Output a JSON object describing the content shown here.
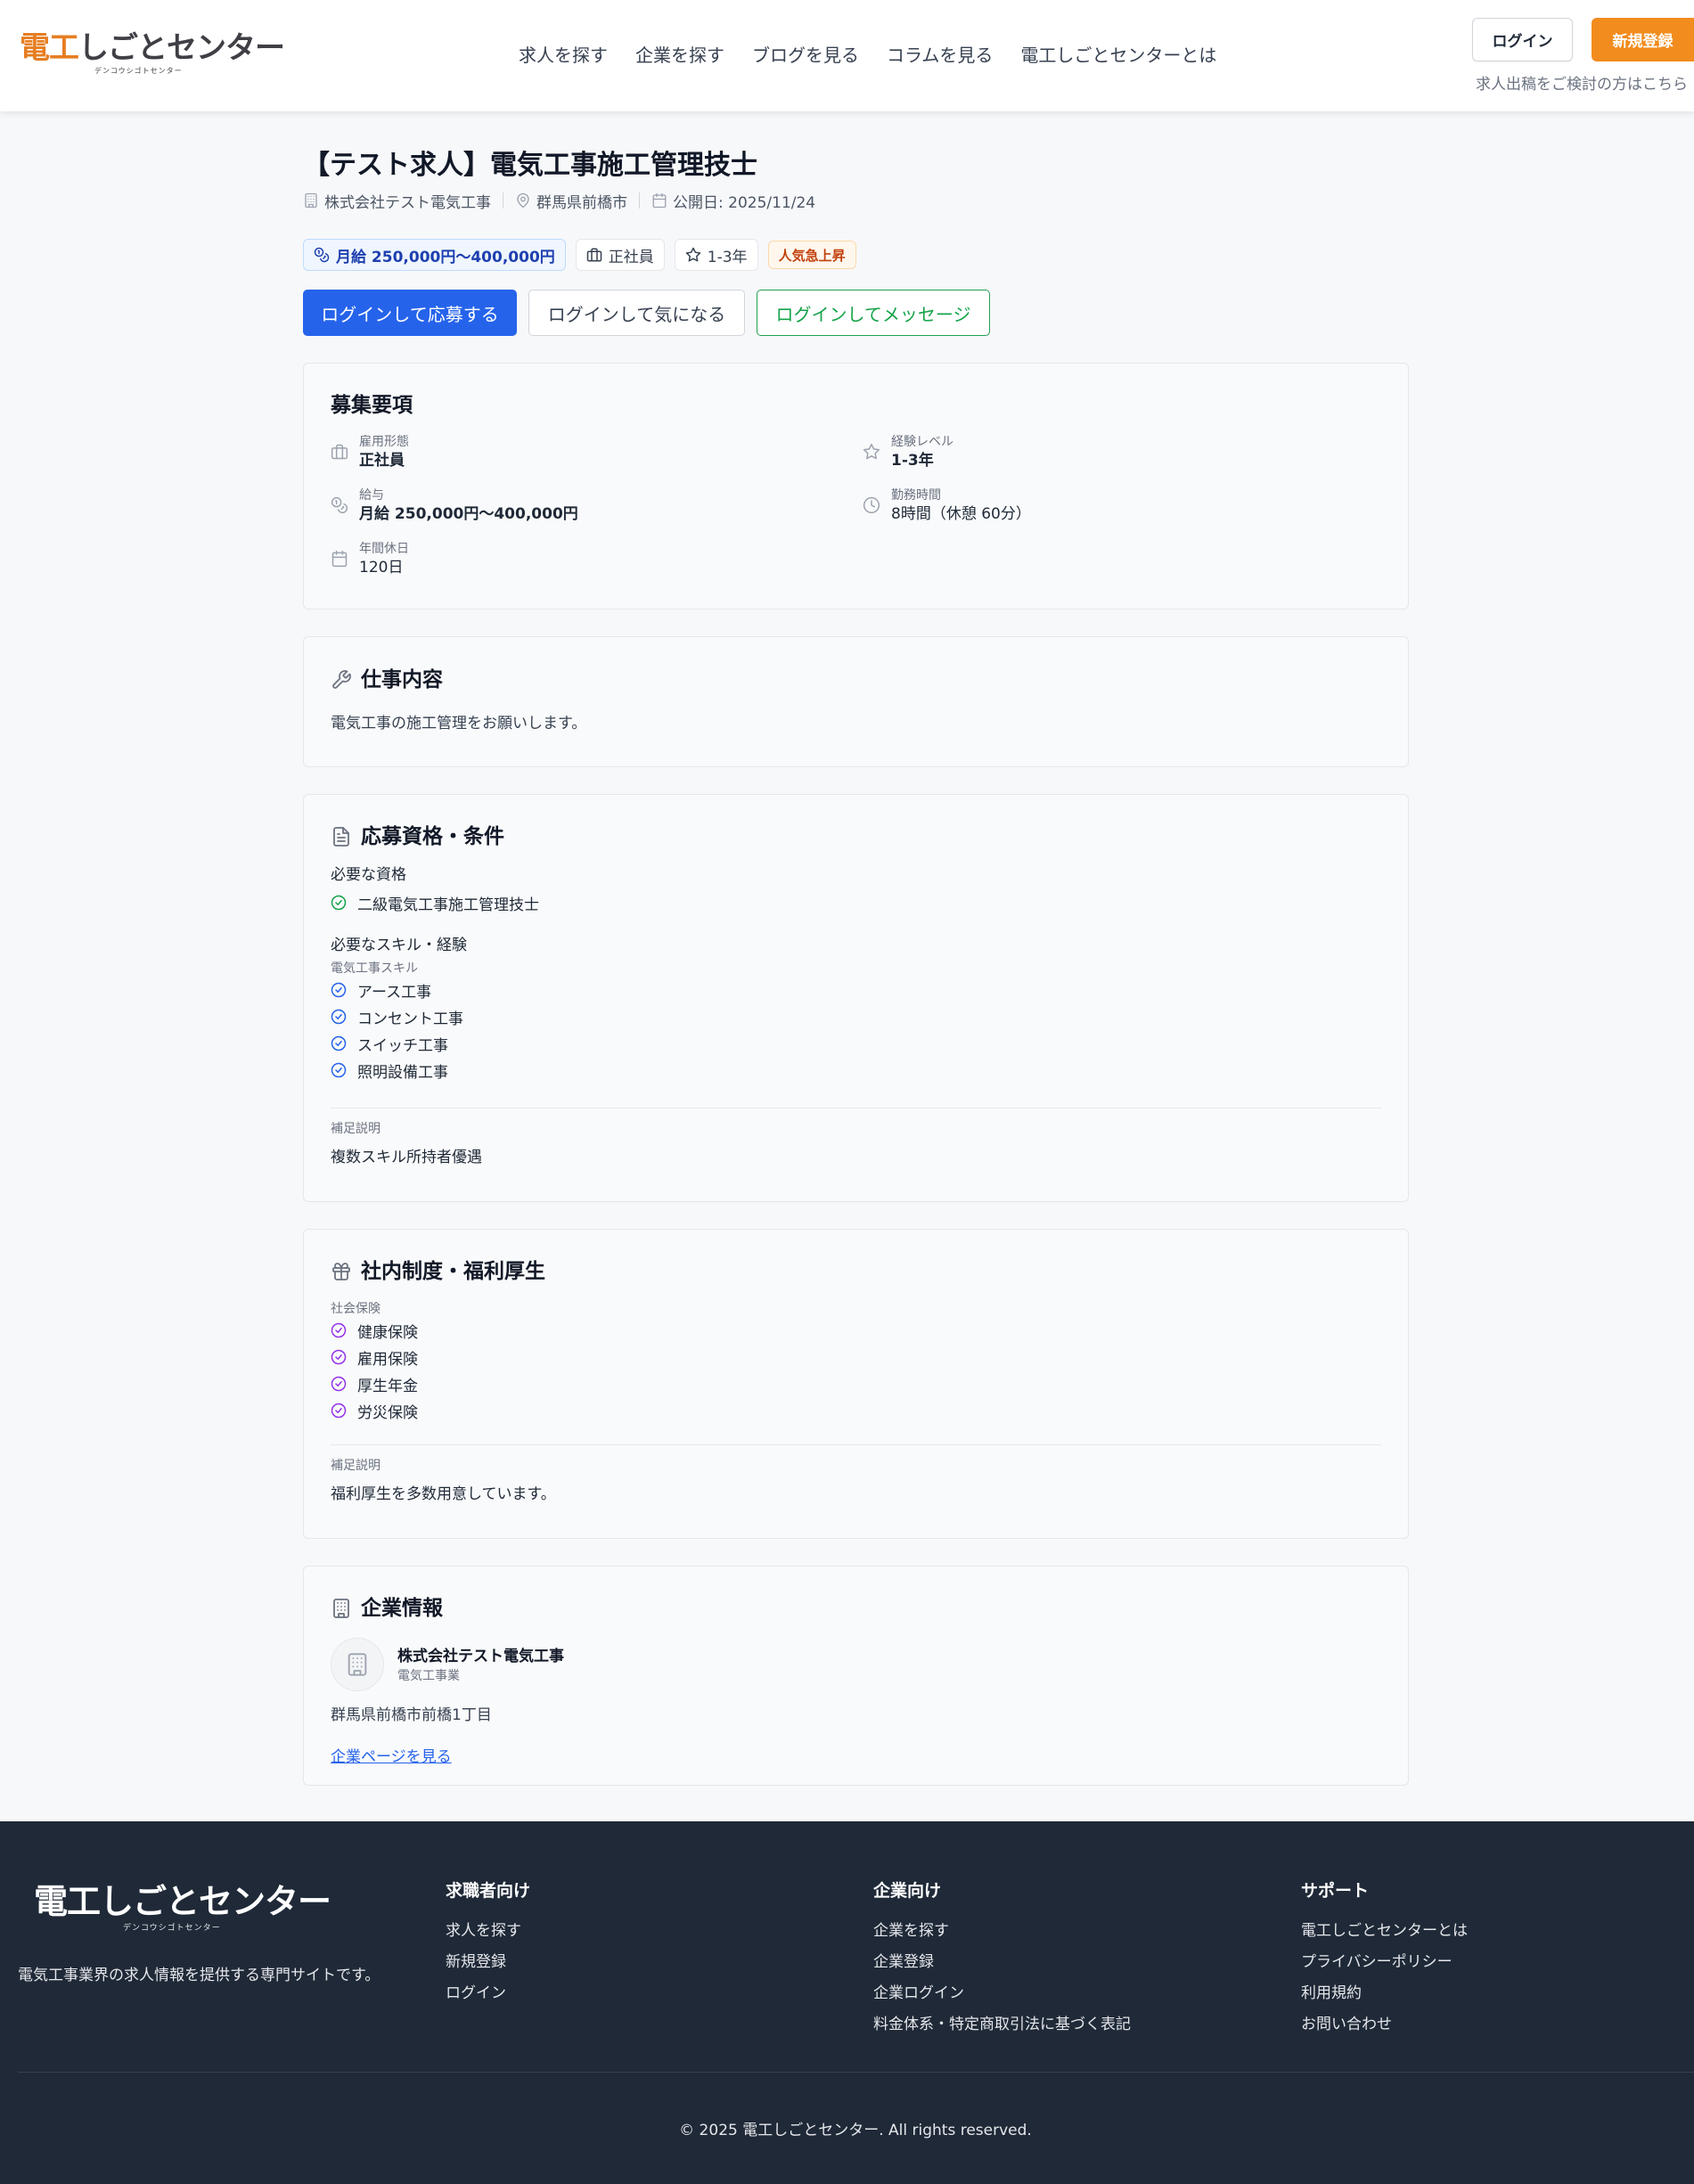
{
  "header": {
    "logo_text": "電工しごとセンター",
    "logo_accent": "電工",
    "logo_rest": "しごとセンター",
    "logo_sub": "デンコウシゴトセンター",
    "nav": [
      "求人を探す",
      "企業を探す",
      "ブログを見る",
      "コラムを見る",
      "電工しごとセンターとは"
    ],
    "login_label": "ログイン",
    "register_label": "新規登録",
    "post_note": "求人出稿をご検討の方はこちら"
  },
  "job": {
    "title": "【テスト求人】電気工事施工管理技士",
    "company": "株式会社テスト電気工事",
    "location": "群馬県前橋市",
    "published": "公開日: 2025/11/24",
    "tags": {
      "salary": "月給 250,000円〜400,000円",
      "employment": "正社員",
      "experience": "1-3年",
      "hot": "人気急上昇"
    },
    "actions": {
      "apply": "ログインして応募する",
      "favorite": "ログインして気になる",
      "message": "ログインしてメッセージ"
    }
  },
  "requirements": {
    "title": "募集要項",
    "fields": {
      "employment_label": "雇用形態",
      "employment_value": "正社員",
      "experience_label": "経験レベル",
      "experience_value": "1-3年",
      "salary_label": "給与",
      "salary_value": "月給 250,000円〜400,000円",
      "hours_label": "勤務時間",
      "hours_value": "8時間（休憩 60分）",
      "holidays_label": "年間休日",
      "holidays_value": "120日"
    }
  },
  "work": {
    "title": "仕事内容",
    "body": "電気工事の施工管理をお願いします。"
  },
  "qualifications": {
    "title": "応募資格・条件",
    "required_head": "必要な資格",
    "required": [
      "二級電気工事施工管理技士"
    ],
    "skills_head": "必要なスキル・経験",
    "skills_category": "電気工事スキル",
    "skills": [
      "アース工事",
      "コンセント工事",
      "スイッチ工事",
      "照明設備工事"
    ],
    "note_label": "補足説明",
    "note": "複数スキル所持者優遇"
  },
  "benefits": {
    "title": "社内制度・福利厚生",
    "category": "社会保険",
    "items": [
      "健康保険",
      "雇用保険",
      "厚生年金",
      "労災保険"
    ],
    "note_label": "補足説明",
    "note": "福利厚生を多数用意しています。"
  },
  "company": {
    "title": "企業情報",
    "name": "株式会社テスト電気工事",
    "industry": "電気工事業",
    "address": "群馬県前橋市前橋1丁目",
    "link": "企業ページを見る"
  },
  "footer": {
    "logo_text": "電工しごとセンター",
    "logo_sub": "デンコウシゴトセンター",
    "description": "電気工事業界の求人情報を提供する専門サイトです。",
    "columns": [
      {
        "title": "求職者向け",
        "links": [
          "求人を探す",
          "新規登録",
          "ログイン"
        ]
      },
      {
        "title": "企業向け",
        "links": [
          "企業を探す",
          "企業登録",
          "企業ログイン",
          "料金体系・特定商取引法に基づく表記"
        ]
      },
      {
        "title": "サポート",
        "links": [
          "電工しごとセンターとは",
          "プライバシーポリシー",
          "利用規約",
          "お問い合わせ"
        ]
      }
    ],
    "copyright": "© 2025 電工しごとセンター. All rights reserved."
  },
  "colors": {
    "primary_blue": "#2563eb",
    "accent_orange": "#f28c1e",
    "success_green": "#16a34a",
    "benefit_purple": "#9333ea",
    "footer_bg": "#1f2937"
  }
}
